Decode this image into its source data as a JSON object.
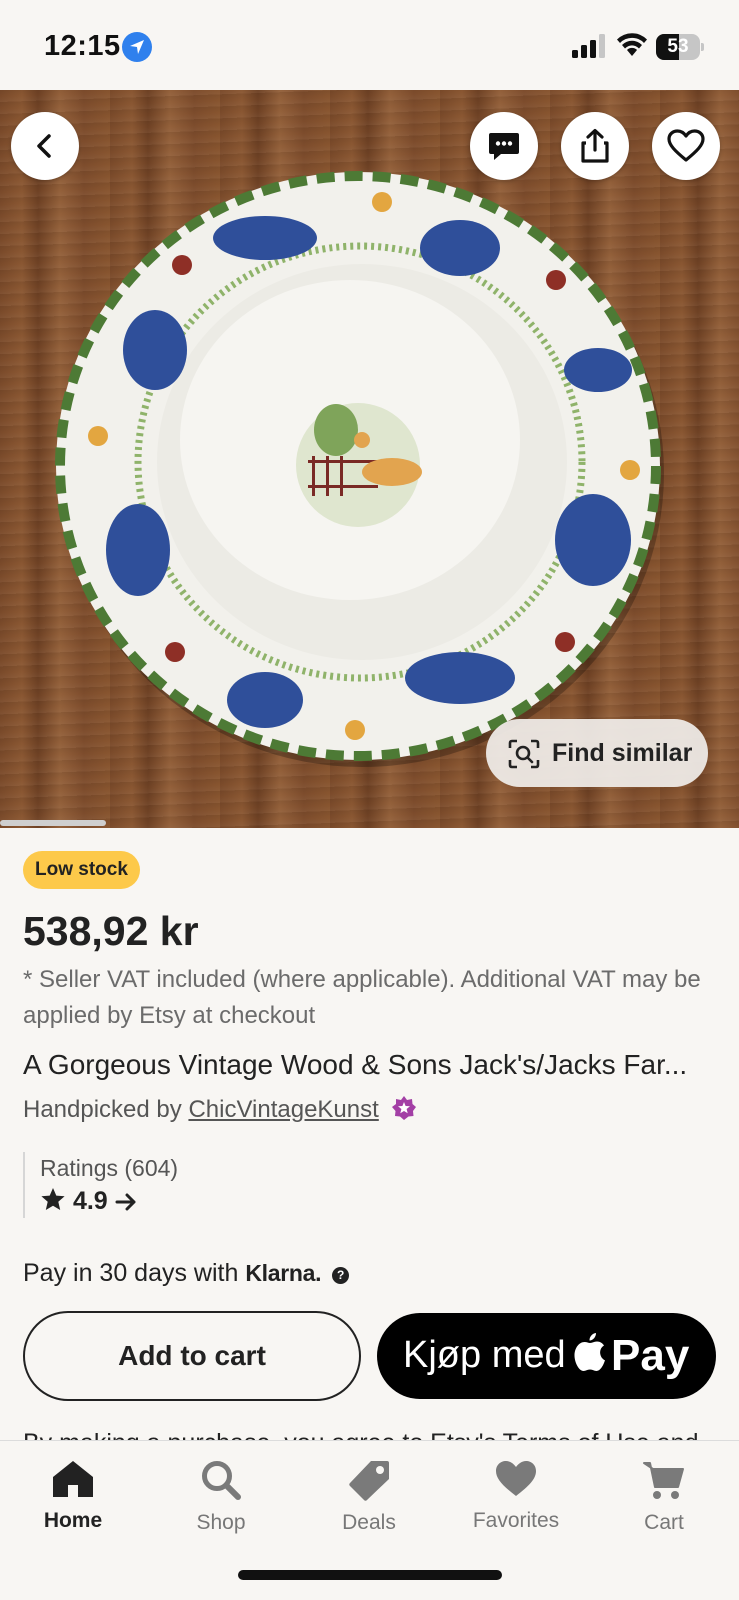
{
  "status_bar": {
    "time": "12:15",
    "battery": "53"
  },
  "hero": {
    "find_similar_label": "Find similar"
  },
  "product": {
    "badge": "Low stock",
    "price": "538,92 kr",
    "vat_note": "* Seller VAT included (where applicable). Additional VAT may be applied by Etsy at checkout",
    "title": "A Gorgeous Vintage Wood & Sons Jack's/Jacks Far...",
    "handpicked_prefix": "Handpicked by ",
    "shop_name": "ChicVintageKunst"
  },
  "ratings": {
    "label": "Ratings (604)",
    "value": "4.9"
  },
  "payment": {
    "klarna_prefix": "Pay in 30 days with ",
    "klarna_brand": "Klarna.",
    "klarna_help": "?",
    "add_to_cart": "Add to cart",
    "apple_pay_prefix": "Kjøp med",
    "apple_pay_word": "Pay"
  },
  "terms_text": "By making a purchase, you agree to Etsy's Terms of Use and",
  "tabbar": {
    "items": [
      {
        "label": "Home",
        "icon": "home-icon",
        "active": true
      },
      {
        "label": "Shop",
        "icon": "search-icon",
        "active": false
      },
      {
        "label": "Deals",
        "icon": "tag-icon",
        "active": false
      },
      {
        "label": "Favorites",
        "icon": "heart-icon",
        "active": false
      },
      {
        "label": "Cart",
        "icon": "cart-icon",
        "active": false
      }
    ]
  },
  "colors": {
    "background": "#f8f6f3",
    "badge": "#fdc94a",
    "star_seller": "#a33fa5",
    "location_blue": "#2f80ed"
  }
}
